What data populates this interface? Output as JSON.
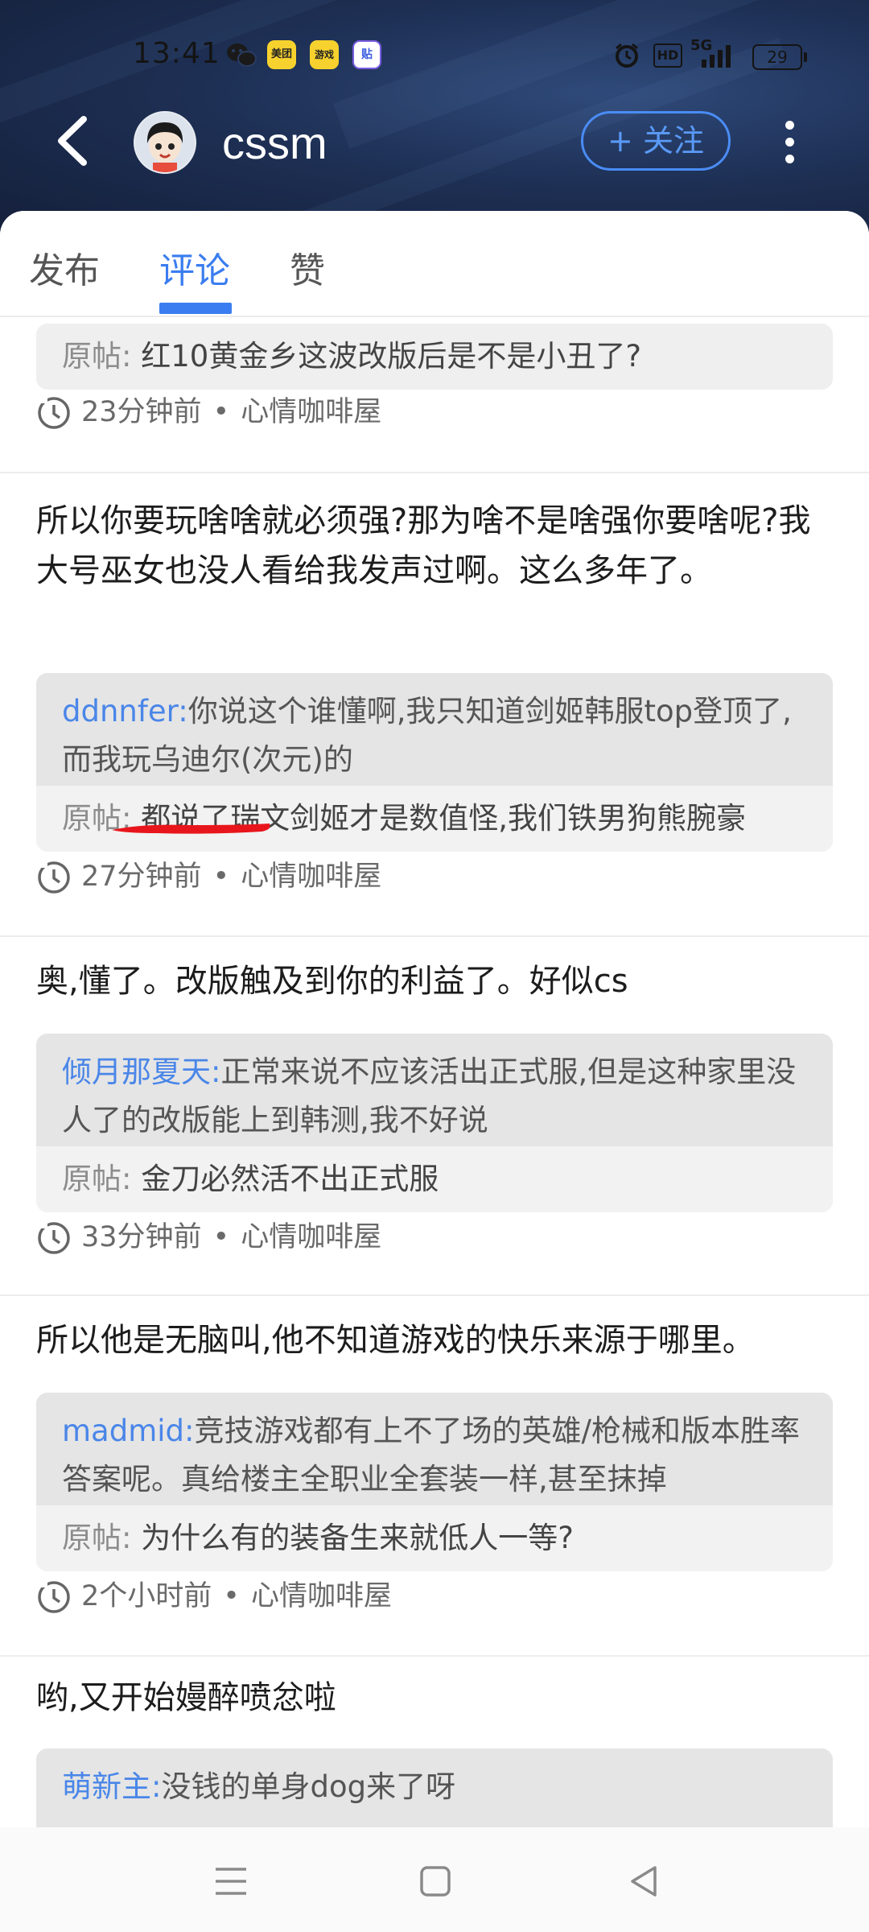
{
  "status_bar": {
    "time": "13:41",
    "apps": [
      {
        "icon": "wechat-icon",
        "label": ""
      },
      {
        "icon": "meituan-icon",
        "label": "美团"
      },
      {
        "icon": "meituan-game-icon",
        "label": "游戏"
      },
      {
        "icon": "tieba-icon",
        "label": "贴"
      }
    ],
    "network": "5G",
    "battery": "29"
  },
  "header": {
    "username": "cssm",
    "follow_label": "+ 关注"
  },
  "tabs": [
    {
      "label": "发布",
      "active": false
    },
    {
      "label": "评论",
      "active": true
    },
    {
      "label": "赞",
      "active": false
    }
  ],
  "feed": [
    {
      "comment": "",
      "reply_user": "",
      "reply_text": "",
      "origin_label": "原帖:",
      "origin_text": "红10黄金乡这波改版后是不是小丑了?",
      "time": "23分钟前",
      "forum": "心情咖啡屋"
    },
    {
      "comment": "所以你要玩啥啥就必须强?那为啥不是啥强你要啥呢?我大号巫女也没人看给我发声过啊。这么多年了。",
      "reply_user": "ddnnfer:",
      "reply_text": "你说这个谁懂啊,我只知道剑姬韩服top登顶了,而我玩乌迪尔(次元)的",
      "origin_label": "原帖:",
      "origin_text": "都说了瑞文剑姬才是数值怪,我们铁男狗熊腕豪",
      "time": "27分钟前",
      "forum": "心情咖啡屋"
    },
    {
      "comment": "奥,懂了。改版触及到你的利益了。好似cs",
      "reply_user": "倾月那夏天:",
      "reply_text": "正常来说不应该活出正式服,但是这种家里没人了的改版能上到韩测,我不好说",
      "origin_label": "原帖:",
      "origin_text": "金刀必然活不出正式服",
      "time": "33分钟前",
      "forum": "心情咖啡屋"
    },
    {
      "comment": "所以他是无脑叫,他不知道游戏的快乐来源于哪里。",
      "reply_user": "madmid:",
      "reply_text": "竞技游戏都有上不了场的英雄/枪械和版本胜率答案呢。真给楼主全职业全套装一样,甚至抹掉",
      "origin_label": "原帖:",
      "origin_text": "为什么有的装备生来就低人一等?",
      "time": "2个小时前",
      "forum": "心情咖啡屋"
    },
    {
      "comment": "哟,又开始嫚醉喷忿啦",
      "reply_user": "萌新主:",
      "reply_text": "没钱的单身dog来了呀",
      "origin_label": "",
      "origin_text": "",
      "time": "",
      "forum": ""
    }
  ],
  "colors": {
    "accent": "#3a7df0",
    "reply_user": "#4a86e8",
    "underline": "#e8161c"
  }
}
